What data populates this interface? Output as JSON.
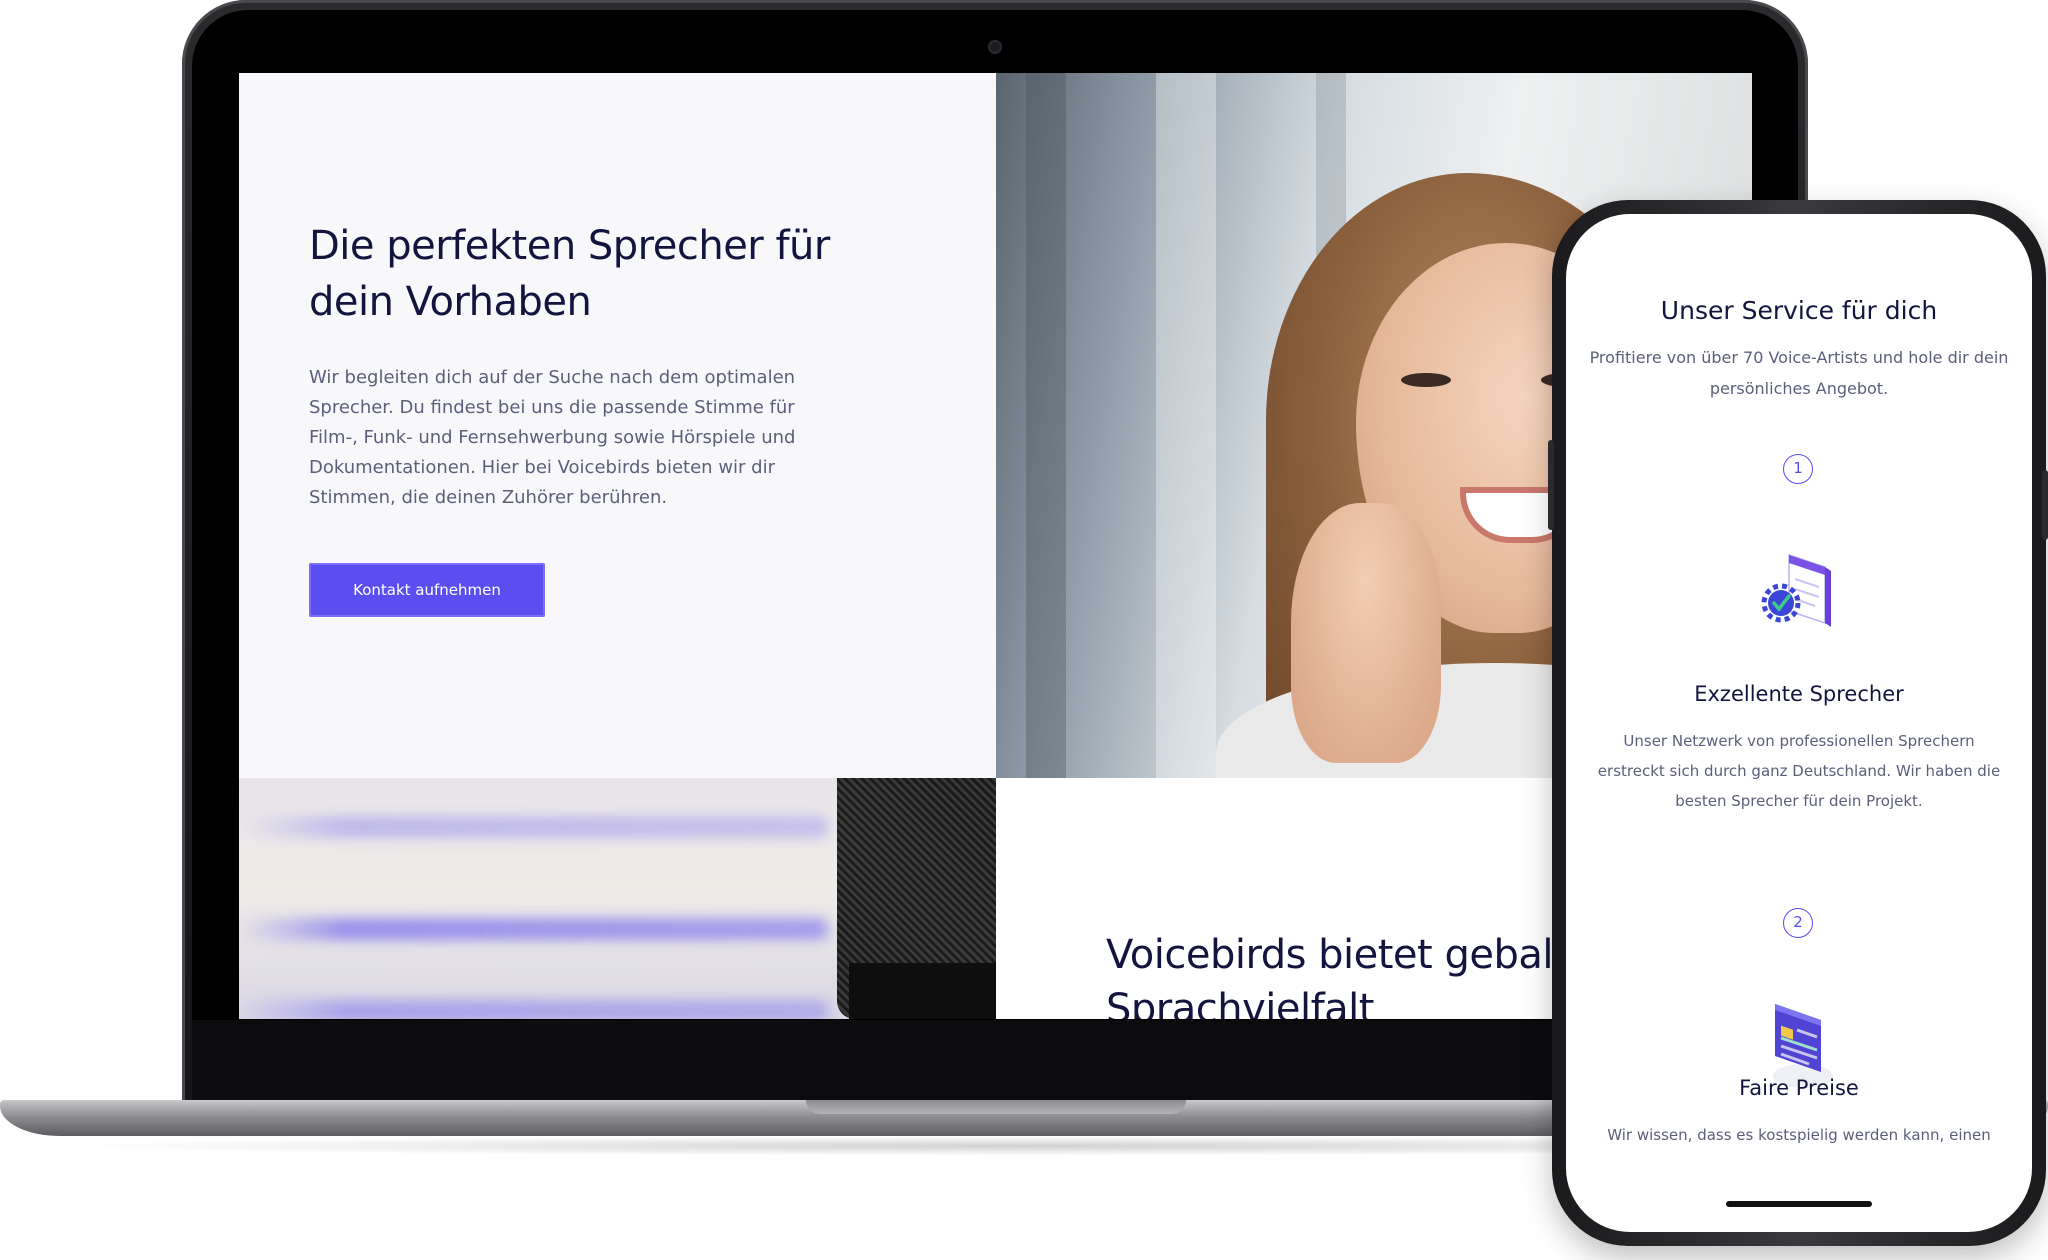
{
  "laptop": {
    "hero": {
      "title": "Die perfekten Sprecher für dein Vorhaben",
      "text": "Wir begleiten dich auf der Suche nach dem optimalen Sprecher. Du findest bei uns die passende Stimme für Film-, Funk- und Fernsehwerbung sowie Hörspiele und Dokumentationen. Hier bei Voicebirds bieten wir dir Stimmen, die deinen Zuhörer berühren.",
      "button_label": "Kontakt aufnehmen"
    },
    "section2": {
      "title": "Voicebirds bietet geballte Sprachvielfalt"
    }
  },
  "phone": {
    "title": "Unser Service für dich",
    "subtitle": "Profitiere von über 70 Voice-Artists und hole dir dein persönliches Angebot.",
    "features": [
      {
        "step": "1",
        "icon": "settings-document-icon",
        "title": "Exzellente Sprecher",
        "text": "Unser Netzwerk von professionellen Sprechern erstreckt sich durch ganz Deutschland. Wir haben die besten Sprecher für dein Projekt."
      },
      {
        "step": "2",
        "icon": "price-list-icon",
        "title": "Faire Preise",
        "text": "Wir wissen, dass es kostspielig werden kann, einen"
      }
    ]
  },
  "colors": {
    "accent": "#5a4ef0",
    "heading": "#13153f",
    "body_text": "#5b5f7a",
    "background": "#f8f8fb"
  }
}
